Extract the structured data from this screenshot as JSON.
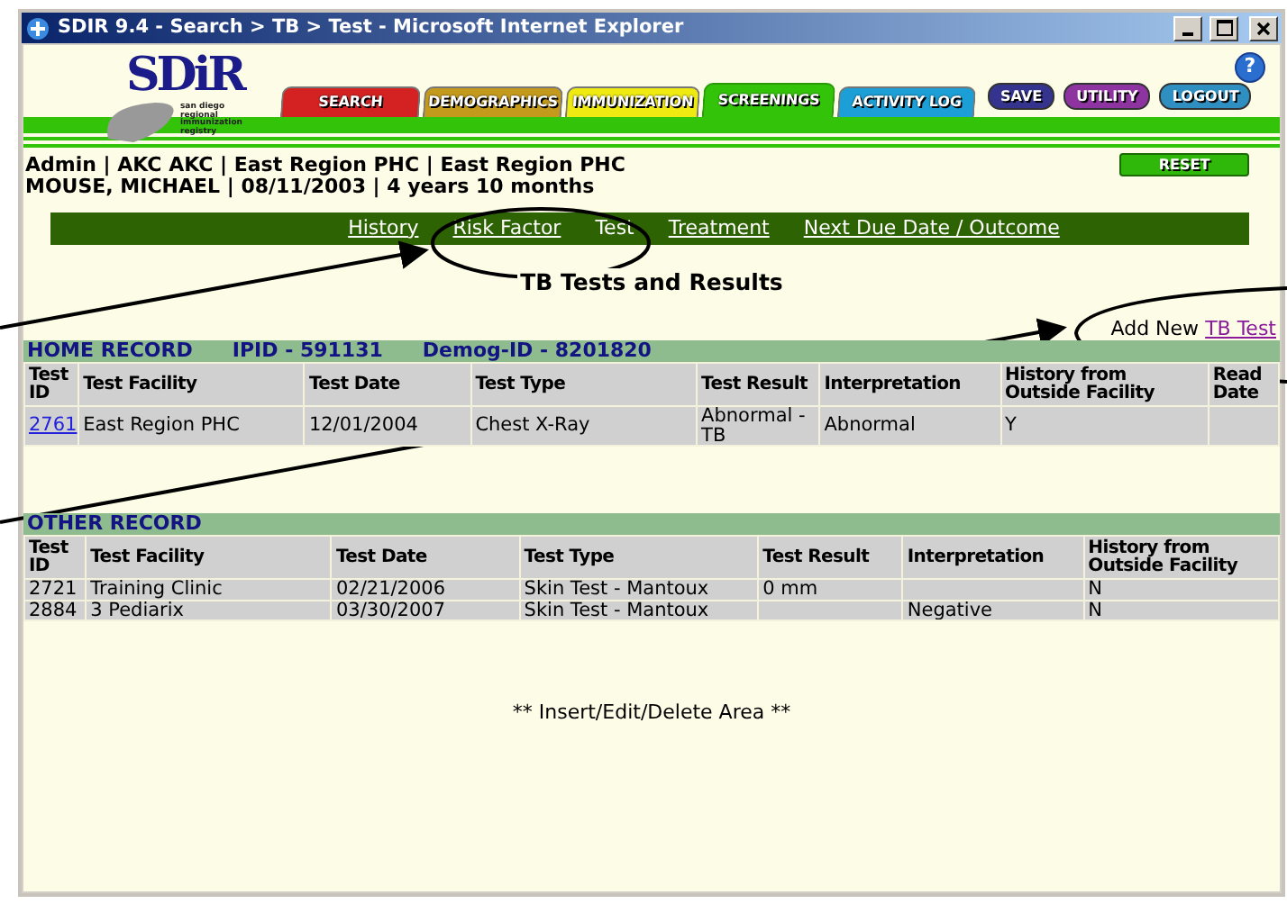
{
  "window": {
    "title": "SDIR 9.4 - Search > TB > Test - Microsoft Internet Explorer"
  },
  "logo": {
    "title": "SDiR",
    "subtitle": "san diego regional immunization registry"
  },
  "help": "?",
  "tabs": [
    {
      "label": "SEARCH",
      "color": "#d42222",
      "selected": false
    },
    {
      "label": "DEMOGRAPHICS",
      "color": "#c49a1c",
      "selected": false
    },
    {
      "label": "IMMUNIZATION",
      "color": "#eeea12",
      "selected": false
    },
    {
      "label": "SCREENINGS",
      "color": "#33c40a",
      "selected": true
    },
    {
      "label": "ACTIVITY LOG",
      "color": "#1b9fd6",
      "selected": false
    }
  ],
  "action_buttons": [
    {
      "label": "SAVE",
      "color": "#34348e"
    },
    {
      "label": "UTILITY",
      "color": "#8e34a0"
    },
    {
      "label": "LOGOUT",
      "color": "#2f8fc0"
    }
  ],
  "patient_info": [
    "Admin | AKC AKC | East Region PHC | East Region PHC",
    "MOUSE, MICHAEL | 08/11/2003 | 4 years 10 months"
  ],
  "reset_button": "RESET",
  "subnav": [
    {
      "label": "History",
      "selected": false
    },
    {
      "label": "Risk Factor",
      "selected": false
    },
    {
      "label": "Test",
      "selected": true
    },
    {
      "label": "Treatment",
      "selected": false
    },
    {
      "label": "Next Due Date / Outcome",
      "selected": false
    }
  ],
  "page_title": "TB Tests and Results",
  "add_new": {
    "text": "Add New",
    "link": "TB Test"
  },
  "records": [
    {
      "title": "HOME RECORD",
      "ids": [
        "IPID - 591131",
        "Demog-ID - 8201820"
      ],
      "id_is_link": true,
      "columns": [
        "Test ID",
        "Test Facility",
        "Test Date",
        "Test Type",
        "Test Result",
        "Interpretation",
        "History from Outside Facility",
        "Read Date"
      ],
      "rows": [
        [
          "2761",
          "East Region PHC",
          "12/01/2004",
          "Chest X-Ray",
          "Abnormal - TB",
          "Abnormal",
          "Y",
          ""
        ]
      ]
    },
    {
      "title": "OTHER RECORD",
      "id_is_link": false,
      "columns": [
        "Test ID",
        "Test Facility",
        "Test Date",
        "Test Type",
        "Test Result",
        "Interpretation",
        "History from Outside Facility"
      ],
      "rows": [
        [
          "2721",
          "Training Clinic",
          "02/21/2006",
          "Skin Test - Mantoux",
          "0 mm",
          "",
          "N"
        ],
        [
          "2884",
          "3 Pediarix",
          "03/30/2007",
          "Skin Test - Mantoux",
          "",
          "Negative",
          "N"
        ]
      ]
    }
  ],
  "insert_area": "** Insert/Edit/Delete Area **"
}
